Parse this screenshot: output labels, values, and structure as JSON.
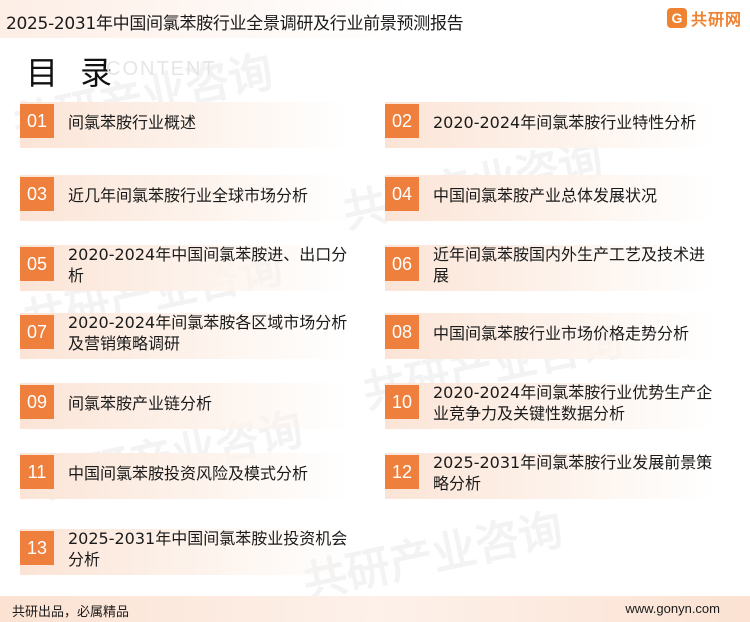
{
  "header": {
    "title": "2025-2031年中国间氯苯胺行业全景调研及行业前景预测报告",
    "logo_mark": "G",
    "logo_text": "共研网"
  },
  "toc": {
    "title": "目 录",
    "subtitle": "CONTENT"
  },
  "watermark_text": "共研产业咨询",
  "items": [
    {
      "num": "01",
      "label": "间氯苯胺行业概述"
    },
    {
      "num": "02",
      "label": "2020-2024年间氯苯胺行业特性分析"
    },
    {
      "num": "03",
      "label": "近几年间氯苯胺行业全球市场分析"
    },
    {
      "num": "04",
      "label": "中国间氯苯胺产业总体发展状况"
    },
    {
      "num": "05",
      "label": "2020-2024年中国间氯苯胺进、出口分析"
    },
    {
      "num": "06",
      "label": "近年间氯苯胺国内外生产工艺及技术进展"
    },
    {
      "num": "07",
      "label": "2020-2024年间氯苯胺各区域市场分析及营销策略调研"
    },
    {
      "num": "08",
      "label": "中国间氯苯胺行业市场价格走势分析"
    },
    {
      "num": "09",
      "label": "间氯苯胺产业链分析"
    },
    {
      "num": "10",
      "label": "2020-2024年间氯苯胺行业优势生产企业竞争力及关键性数据分析"
    },
    {
      "num": "11",
      "label": "中国间氯苯胺投资风险及模式分析"
    },
    {
      "num": "12",
      "label": "2025-2031年间氯苯胺行业发展前景策略分析"
    },
    {
      "num": "13",
      "label": "2025-2031年中国间氯苯胺业投资机会分析"
    }
  ],
  "footer": {
    "left": "共研出品，必属精品",
    "right": "www.gonyn.com"
  },
  "colors": {
    "accent": "#ee7f3c",
    "bar_light": "#fbe4d6"
  }
}
